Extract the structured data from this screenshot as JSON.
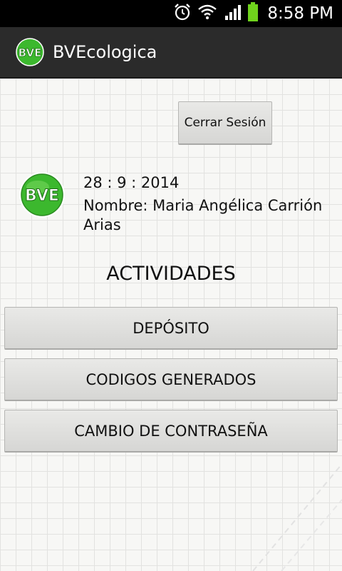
{
  "status_bar": {
    "time": "8:58 PM",
    "icons": [
      "alarm-icon",
      "wifi-icon",
      "signal-icon",
      "battery-icon"
    ]
  },
  "app": {
    "title": "BVEcologica",
    "logo_text": "BVE"
  },
  "main": {
    "logout_label": "Cerrar Sesión",
    "date": "28 : 9 : 2014",
    "name": "Nombre: Maria Angélica  Carrión Arias",
    "user_logo_text": "BVE",
    "section_title": "ACTIVIDADES",
    "menu": [
      {
        "label": "DEPÓSITO"
      },
      {
        "label": "CODIGOS GENERADOS"
      },
      {
        "label": "CAMBIO DE CONTRASEÑA"
      }
    ]
  },
  "colors": {
    "status_bar_bg": "#000000",
    "action_bar_bg": "#2b2b2b",
    "logo_green": "#3cb82e",
    "battery_green": "#6fd31c",
    "paper_bg": "#f7f7f5",
    "button_bg": "#dcdcda"
  }
}
